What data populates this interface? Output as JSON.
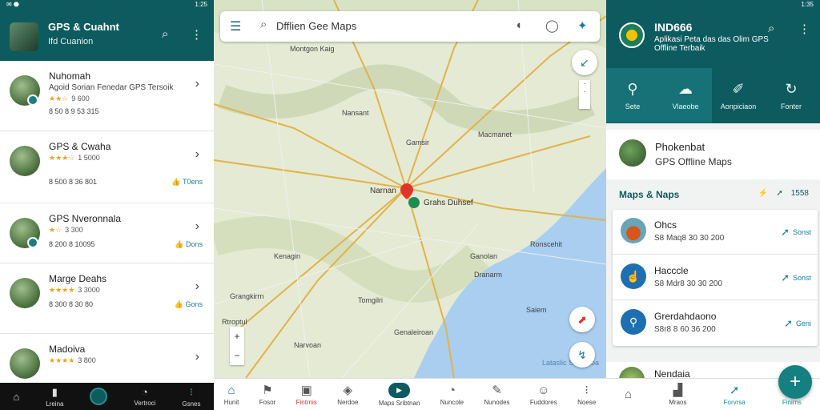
{
  "status": {
    "time_left": "1:25",
    "time_right": "1:35"
  },
  "left": {
    "title": "GPS & Cuahnt",
    "subtitle": "Ifd Cuanion",
    "items": [
      {
        "name": "Nuhomah",
        "desc": "Agoid Sorian Fenedar GPS Tersoik",
        "stars": "★★☆",
        "rating": "9 600",
        "meta": "8 50  8 9 53 315",
        "like": ""
      },
      {
        "name": "GPS & Cwaha",
        "desc": "",
        "stars": "★★★☆",
        "rating": "1 5000",
        "meta": "8 500 8 36 801",
        "like": "T0ens"
      },
      {
        "name": "GPS Nveronnala",
        "desc": "",
        "stars": "★☆",
        "rating": "3 300",
        "meta": "8 200 8 10095",
        "like": "Dons"
      },
      {
        "name": "Marge Deahs",
        "desc": "",
        "stars": "★★★★",
        "rating": "3 3000",
        "meta": "8 300 8 30 80",
        "like": "Gons"
      },
      {
        "name": "Madoiva",
        "desc": "",
        "stars": "★★★★",
        "rating": "3 800",
        "meta": "",
        "like": ""
      }
    ],
    "nav": [
      "Lreina",
      "",
      "Vertroci",
      "Gsnes"
    ]
  },
  "map": {
    "search": "Dfflien Gee Maps",
    "labels": {
      "city_left": "Narnan",
      "city_right": "Grahs Duhsef",
      "top": "Montgon Kaig",
      "l1": "Gamsir",
      "l2": "Kenagin",
      "l3": "Grangkirrn",
      "l4": "Narvoan",
      "l5": "Tomgilri",
      "l6": "Genaleiroan",
      "l7": "Rtroptul",
      "l8": "Ganolan",
      "l9": "Dranarm",
      "l10": "Nansant",
      "l11": "Macmanet",
      "l12": "Ronscehit",
      "l13": "Saiem",
      "l14": "Lataslic Sbi Mhoa"
    },
    "nav": [
      "Hunit",
      "Fosor",
      "Fintrnis",
      "Nerdoe",
      "Maps Sribtnan",
      "Nuncole",
      "Nunodes",
      "Fuddores",
      "Noese"
    ]
  },
  "right": {
    "title": "IND666",
    "subtitle": "Aplikasi Peta das das Olim GPS Offline Terbaik",
    "actions": [
      "Sete",
      "Vlaeobe",
      "Aonpiciaon",
      "Fonter"
    ],
    "featured": {
      "name": "Phokenbat",
      "sub": "GPS Offline Maps"
    },
    "section": "Maps & Naps",
    "section_count": "1558",
    "rows": [
      {
        "name": "Ohcs",
        "date": "S8 Maq8 30 30 200",
        "stat": "Sonst"
      },
      {
        "name": "Hacccle",
        "date": "S8 Mdr8 30 30 200",
        "stat": "Sonst"
      },
      {
        "name": "Grerdahdaono",
        "date": "S8r8 8 60 36 200",
        "stat": "Geni"
      }
    ],
    "bottom_item": "Nendaia",
    "nav": [
      "Mraos",
      "Forvrsa",
      "Finirns"
    ]
  }
}
